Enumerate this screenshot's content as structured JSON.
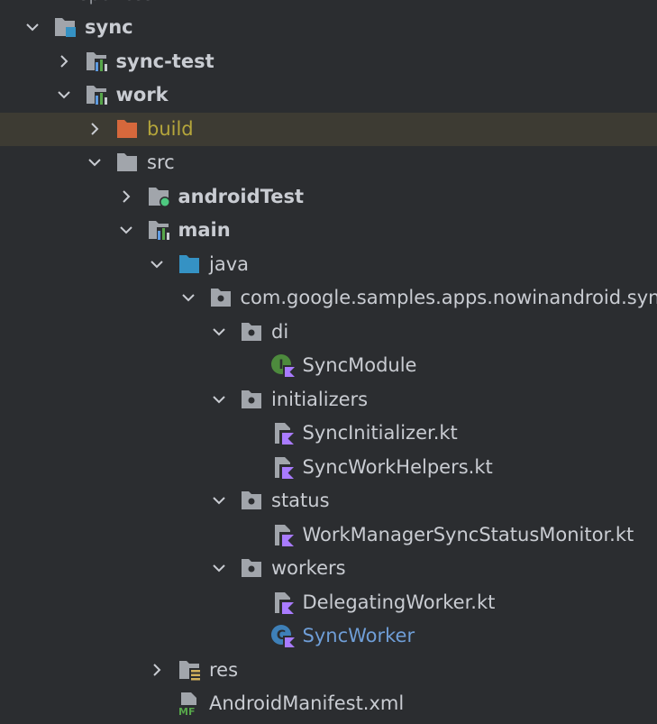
{
  "tree": {
    "cutoff_label": "spotless",
    "rows": [
      {
        "label": "sync",
        "icon": "module-folder-icon",
        "arrow": "expanded",
        "indent": 0,
        "bold": true
      },
      {
        "label": "sync-test",
        "icon": "android-module-icon",
        "arrow": "collapsed",
        "indent": 1,
        "bold": true
      },
      {
        "label": "work",
        "icon": "android-module-icon",
        "arrow": "expanded",
        "indent": 1,
        "bold": true
      },
      {
        "label": "build",
        "icon": "excluded-folder-icon",
        "arrow": "collapsed",
        "indent": 2,
        "selected": true,
        "color": "#b5a63b"
      },
      {
        "label": "src",
        "icon": "folder-icon",
        "arrow": "expanded",
        "indent": 2
      },
      {
        "label": "androidTest",
        "icon": "test-folder-icon",
        "arrow": "collapsed",
        "indent": 3,
        "bold": true
      },
      {
        "label": "main",
        "icon": "android-module-icon",
        "arrow": "expanded",
        "indent": 3,
        "bold": true
      },
      {
        "label": "java",
        "icon": "source-root-icon",
        "arrow": "expanded",
        "indent": 4
      },
      {
        "label": "com.google.samples.apps.nowinandroid.sync",
        "icon": "package-icon",
        "arrow": "expanded",
        "indent": 5
      },
      {
        "label": "di",
        "icon": "package-icon",
        "arrow": "expanded",
        "indent": 6
      },
      {
        "label": "SyncModule",
        "icon": "kotlin-interface-icon",
        "arrow": "none",
        "indent": 7
      },
      {
        "label": "initializers",
        "icon": "package-icon",
        "arrow": "expanded",
        "indent": 6
      },
      {
        "label": "SyncInitializer.kt",
        "icon": "kotlin-file-icon",
        "arrow": "none",
        "indent": 7
      },
      {
        "label": "SyncWorkHelpers.kt",
        "icon": "kotlin-file-icon",
        "arrow": "none",
        "indent": 7
      },
      {
        "label": "status",
        "icon": "package-icon",
        "arrow": "expanded",
        "indent": 6
      },
      {
        "label": "WorkManagerSyncStatusMonitor.kt",
        "icon": "kotlin-file-icon",
        "arrow": "none",
        "indent": 7
      },
      {
        "label": "workers",
        "icon": "package-icon",
        "arrow": "expanded",
        "indent": 6
      },
      {
        "label": "DelegatingWorker.kt",
        "icon": "kotlin-file-icon",
        "arrow": "none",
        "indent": 7
      },
      {
        "label": "SyncWorker",
        "icon": "kotlin-class-icon",
        "arrow": "none",
        "indent": 7,
        "color": "#6f9ed7"
      },
      {
        "label": "res",
        "icon": "resources-folder-icon",
        "arrow": "collapsed",
        "indent": 4
      },
      {
        "label": "AndroidManifest.xml",
        "icon": "manifest-icon",
        "arrow": "none",
        "indent": 4
      }
    ]
  }
}
